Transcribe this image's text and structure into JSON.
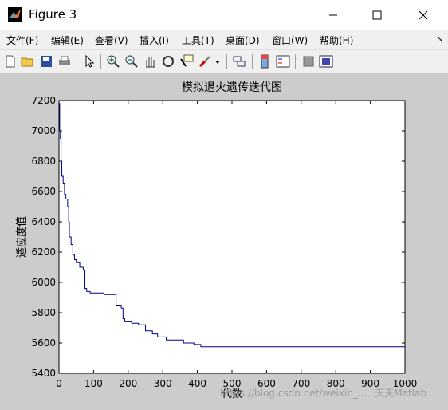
{
  "window": {
    "title": "Figure 3",
    "controls": [
      "minimize",
      "maximize",
      "close"
    ]
  },
  "menu": {
    "items": [
      "文件(F)",
      "编辑(E)",
      "查看(V)",
      "插入(I)",
      "工具(T)",
      "桌面(D)",
      "窗口(W)",
      "帮助(H)"
    ]
  },
  "toolbar": {
    "icons": [
      "new-figure-icon",
      "open-file-icon",
      "save-icon",
      "print-icon",
      "pointer-icon",
      "zoom-in-icon",
      "zoom-out-icon",
      "pan-icon",
      "rotate-3d-icon",
      "data-cursor-icon",
      "brush-icon",
      "brush-dropdown-icon",
      "link-plot-icon",
      "colorbar-icon",
      "legend-icon",
      "hide-plot-tools-icon",
      "show-plot-tools-icon"
    ]
  },
  "watermark": {
    "text": "https://blog.csdn.net/weixin_...",
    "brand": "天天Matlab"
  },
  "chart_data": {
    "type": "line",
    "title": "模拟退火遗传迭代图",
    "xlabel": "代数",
    "ylabel": "适应度值",
    "xlim": [
      0,
      1000
    ],
    "ylim": [
      5400,
      7200
    ],
    "xticks": [
      "0",
      "100",
      "200",
      "300",
      "400",
      "500",
      "600",
      "700",
      "800",
      "900",
      "1000"
    ],
    "yticks": [
      "5400",
      "5600",
      "5800",
      "6000",
      "6200",
      "6400",
      "6600",
      "6800",
      "7000",
      "7200"
    ],
    "grid": false,
    "series": [
      {
        "color": "#00008b",
        "step": true,
        "points": [
          [
            1,
            7180
          ],
          [
            2,
            7000
          ],
          [
            4,
            6950
          ],
          [
            6,
            6800
          ],
          [
            8,
            6700
          ],
          [
            12,
            6650
          ],
          [
            16,
            6580
          ],
          [
            20,
            6550
          ],
          [
            25,
            6500
          ],
          [
            28,
            6400
          ],
          [
            30,
            6300
          ],
          [
            35,
            6250
          ],
          [
            40,
            6180
          ],
          [
            45,
            6150
          ],
          [
            50,
            6130
          ],
          [
            60,
            6100
          ],
          [
            70,
            6080
          ],
          [
            75,
            5960
          ],
          [
            80,
            5940
          ],
          [
            90,
            5930
          ],
          [
            130,
            5920
          ],
          [
            165,
            5850
          ],
          [
            180,
            5830
          ],
          [
            185,
            5760
          ],
          [
            190,
            5740
          ],
          [
            210,
            5730
          ],
          [
            230,
            5720
          ],
          [
            250,
            5680
          ],
          [
            270,
            5660
          ],
          [
            285,
            5640
          ],
          [
            310,
            5620
          ],
          [
            360,
            5600
          ],
          [
            390,
            5590
          ],
          [
            410,
            5575
          ],
          [
            1000,
            5575
          ]
        ]
      }
    ]
  }
}
